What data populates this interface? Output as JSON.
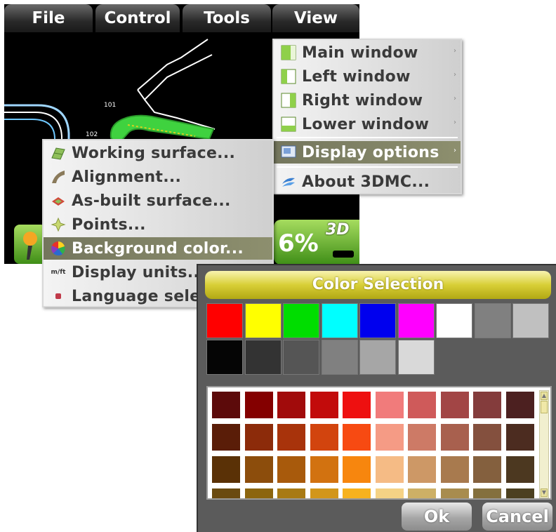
{
  "menubar": {
    "items": [
      "File",
      "Control",
      "Tools",
      "View"
    ]
  },
  "map": {
    "labels": [
      "101",
      "102"
    ]
  },
  "status": {
    "percent": "6%",
    "mode": "3D"
  },
  "view_menu": {
    "items": [
      {
        "label": "Main window",
        "icon": "main-window-icon",
        "submenu": true
      },
      {
        "label": "Left window",
        "icon": "left-window-icon",
        "submenu": true
      },
      {
        "label": "Right window",
        "icon": "right-window-icon",
        "submenu": true
      },
      {
        "label": "Lower window",
        "icon": "lower-window-icon",
        "submenu": true
      },
      {
        "label": "Display options",
        "icon": "display-options-icon",
        "submenu": true,
        "selected": true
      },
      {
        "label": "About 3DMC...",
        "icon": "about-icon",
        "submenu": false
      }
    ]
  },
  "tools_menu": {
    "items": [
      {
        "label": "Working surface...",
        "icon": "working-surface-icon"
      },
      {
        "label": "Alignment...",
        "icon": "alignment-icon"
      },
      {
        "label": "As-built surface...",
        "icon": "as-built-surface-icon"
      },
      {
        "label": "Points...",
        "icon": "points-icon"
      },
      {
        "label": "Background color...",
        "icon": "color-wheel-icon",
        "selected": true
      },
      {
        "label": "Display units...",
        "icon": "units-icon",
        "icon_text": "m/ft"
      },
      {
        "label": "Language sele",
        "icon": "language-icon"
      }
    ]
  },
  "color_dialog": {
    "title": "Color Selection",
    "basic_colors": [
      "#ff0000",
      "#ffff00",
      "#00dd00",
      "#00ffff",
      "#0000ee",
      "#ff00ff",
      "#ffffff",
      "#808080",
      "#c0c0c0",
      "#050505",
      "#333333",
      "#555555",
      "#808080",
      "#a6a6a6",
      "#d9d9d9"
    ],
    "palette_rows": [
      [
        "#5c0a0a",
        "#840000",
        "#a10b0b",
        "#c20b0b",
        "#ee1010",
        "#f17b7b",
        "#cf5a5a",
        "#a24545",
        "#843c3c",
        "#4c2020"
      ],
      [
        "#5a1d08",
        "#8c2b0a",
        "#a8330b",
        "#d2440e",
        "#f74a12",
        "#f59b85",
        "#cd7a66",
        "#a8604e",
        "#84503e",
        "#4c2c20"
      ],
      [
        "#5a3106",
        "#8c4d0c",
        "#a85a0c",
        "#d27210",
        "#f7860e",
        "#f5bb85",
        "#cd9866",
        "#a87a4e",
        "#84603e",
        "#4c3820"
      ],
      [
        "#6a4a10",
        "#8c650e",
        "#a87a14",
        "#d2961a",
        "#f7b21e",
        "#f5d285",
        "#cdb066",
        "#a88c4e",
        "#84703e",
        "#4c4020"
      ]
    ],
    "ok_label": "Ok",
    "cancel_label": "Cancel"
  }
}
